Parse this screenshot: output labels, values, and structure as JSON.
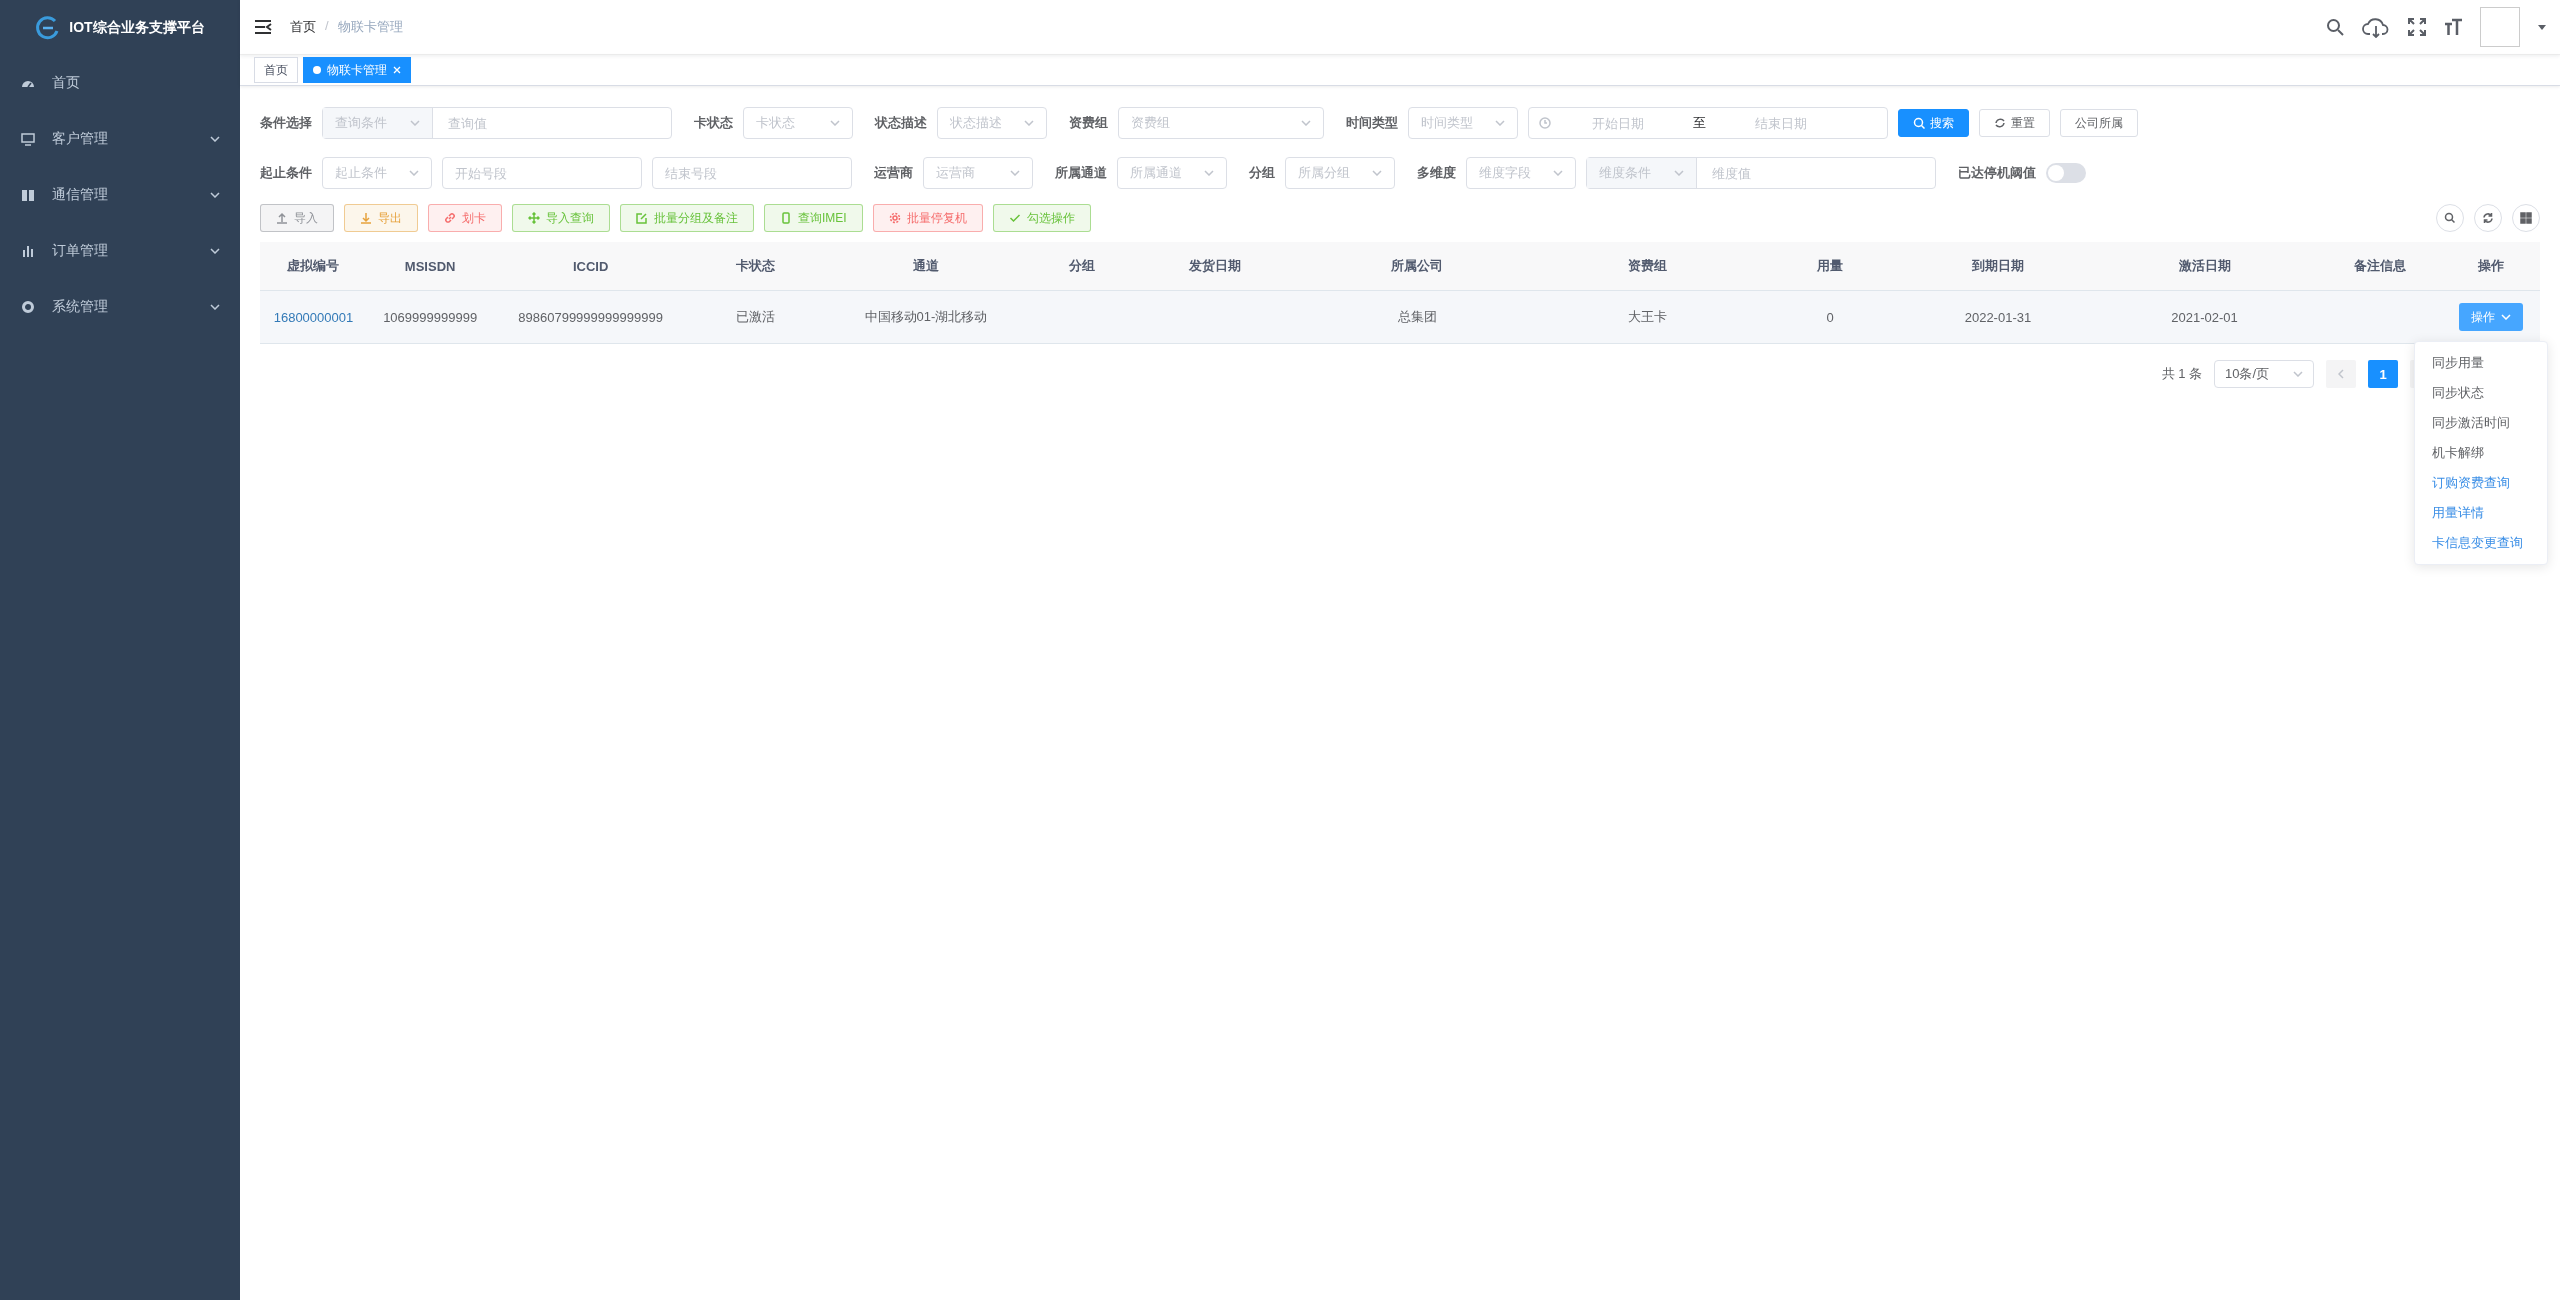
{
  "sidebar": {
    "title": "IOT综合业务支撑平台",
    "items": [
      {
        "label": "首页"
      },
      {
        "label": "客户管理",
        "expanded": false
      },
      {
        "label": "通信管理",
        "expanded": false
      },
      {
        "label": "订单管理",
        "expanded": false
      },
      {
        "label": "系统管理",
        "expanded": false
      }
    ]
  },
  "header": {
    "breadcrumb": [
      "首页",
      "物联卡管理"
    ],
    "separator": "/"
  },
  "tags": [
    {
      "label": "首页",
      "selected": false
    },
    {
      "label": "物联卡管理",
      "selected": true
    }
  ],
  "filter_rows": [
    {
      "fields": [
        {
          "kind": "combo",
          "label": "条件选择",
          "select_placeholder": "查询条件",
          "placeholder": "查询值"
        },
        {
          "kind": "select",
          "label": "卡状态",
          "placeholder": "卡状态"
        },
        {
          "kind": "select",
          "label": "状态描述",
          "placeholder": "状态描述"
        },
        {
          "kind": "wideselect",
          "label": "资费组",
          "placeholder": "资费组"
        },
        {
          "kind": "select",
          "label": "时间类型",
          "placeholder": "时间类型"
        },
        {
          "kind": "daterange",
          "start_placeholder": "开始日期",
          "separator": "至",
          "end_placeholder": "结束日期"
        },
        {
          "kind": "button",
          "label": "搜索",
          "primary": true
        },
        {
          "kind": "button",
          "label": "重置",
          "primary": false
        },
        {
          "kind": "button",
          "label": "公司所属",
          "primary": false
        }
      ]
    },
    {
      "fields": [
        {
          "kind": "select",
          "label": "起止条件",
          "placeholder": "起止条件"
        },
        {
          "kind": "input",
          "placeholder": "开始号段"
        },
        {
          "kind": "input",
          "placeholder": "结束号段"
        },
        {
          "kind": "select",
          "label": "运营商",
          "placeholder": "运营商"
        },
        {
          "kind": "select",
          "label": "所属通道",
          "placeholder": "所属通道"
        },
        {
          "kind": "select",
          "label": "分组",
          "placeholder": "所属分组"
        },
        {
          "kind": "select",
          "label": "多维度",
          "placeholder": "维度字段"
        },
        {
          "kind": "combo",
          "select_placeholder": "维度条件",
          "placeholder": "维度值"
        },
        {
          "kind": "switch",
          "label": "已达停机阈值",
          "on": false
        }
      ]
    }
  ],
  "actions": [
    {
      "label": "导入",
      "color": "#909399"
    },
    {
      "label": "导出",
      "color": "#e6a23c"
    },
    {
      "label": "划卡",
      "color": "#f56c6c"
    },
    {
      "label": "导入查询",
      "color": "#67c23a"
    },
    {
      "label": "批量分组及备注",
      "color": "#67c23a"
    },
    {
      "label": "查询IMEI",
      "color": "#67c23a"
    },
    {
      "label": "批量停复机",
      "color": "#f56c6c"
    },
    {
      "label": "勾选操作",
      "color": "#67c23a"
    }
  ],
  "table": {
    "columns": [
      "虚拟编号",
      "MSISDN",
      "ICCID",
      "卡状态",
      "通道",
      "分组",
      "发货日期",
      "所属公司",
      "资费组",
      "用量",
      "到期日期",
      "激活日期",
      "备注信息",
      "操作"
    ],
    "rows": [
      {
        "cells": [
          "16800000001",
          "1069999999999",
          "89860799999999999999",
          "已激活",
          "中国移动01-湖北移动",
          "",
          "",
          "总集团",
          "大王卡",
          "0",
          "2022-01-31",
          "2021-02-01",
          ""
        ],
        "action": "操作"
      }
    ]
  },
  "action_menu": {
    "items": [
      {
        "label": "同步用量",
        "color": "#606266"
      },
      {
        "label": "同步状态",
        "color": "#606266"
      },
      {
        "label": "同步激活时间",
        "color": "#606266"
      },
      {
        "label": "机卡解绑",
        "color": "#606266"
      },
      {
        "label": "订购资费查询",
        "color": "#3a8ee6"
      },
      {
        "label": "用量详情",
        "color": "#3a8ee6"
      },
      {
        "label": "卡信息变更查询",
        "color": "#3a8ee6"
      }
    ]
  },
  "pagination": {
    "total": "共 1 条",
    "page_size": "10条/页",
    "pages": [
      {
        "label": "1",
        "selected": true
      }
    ]
  }
}
